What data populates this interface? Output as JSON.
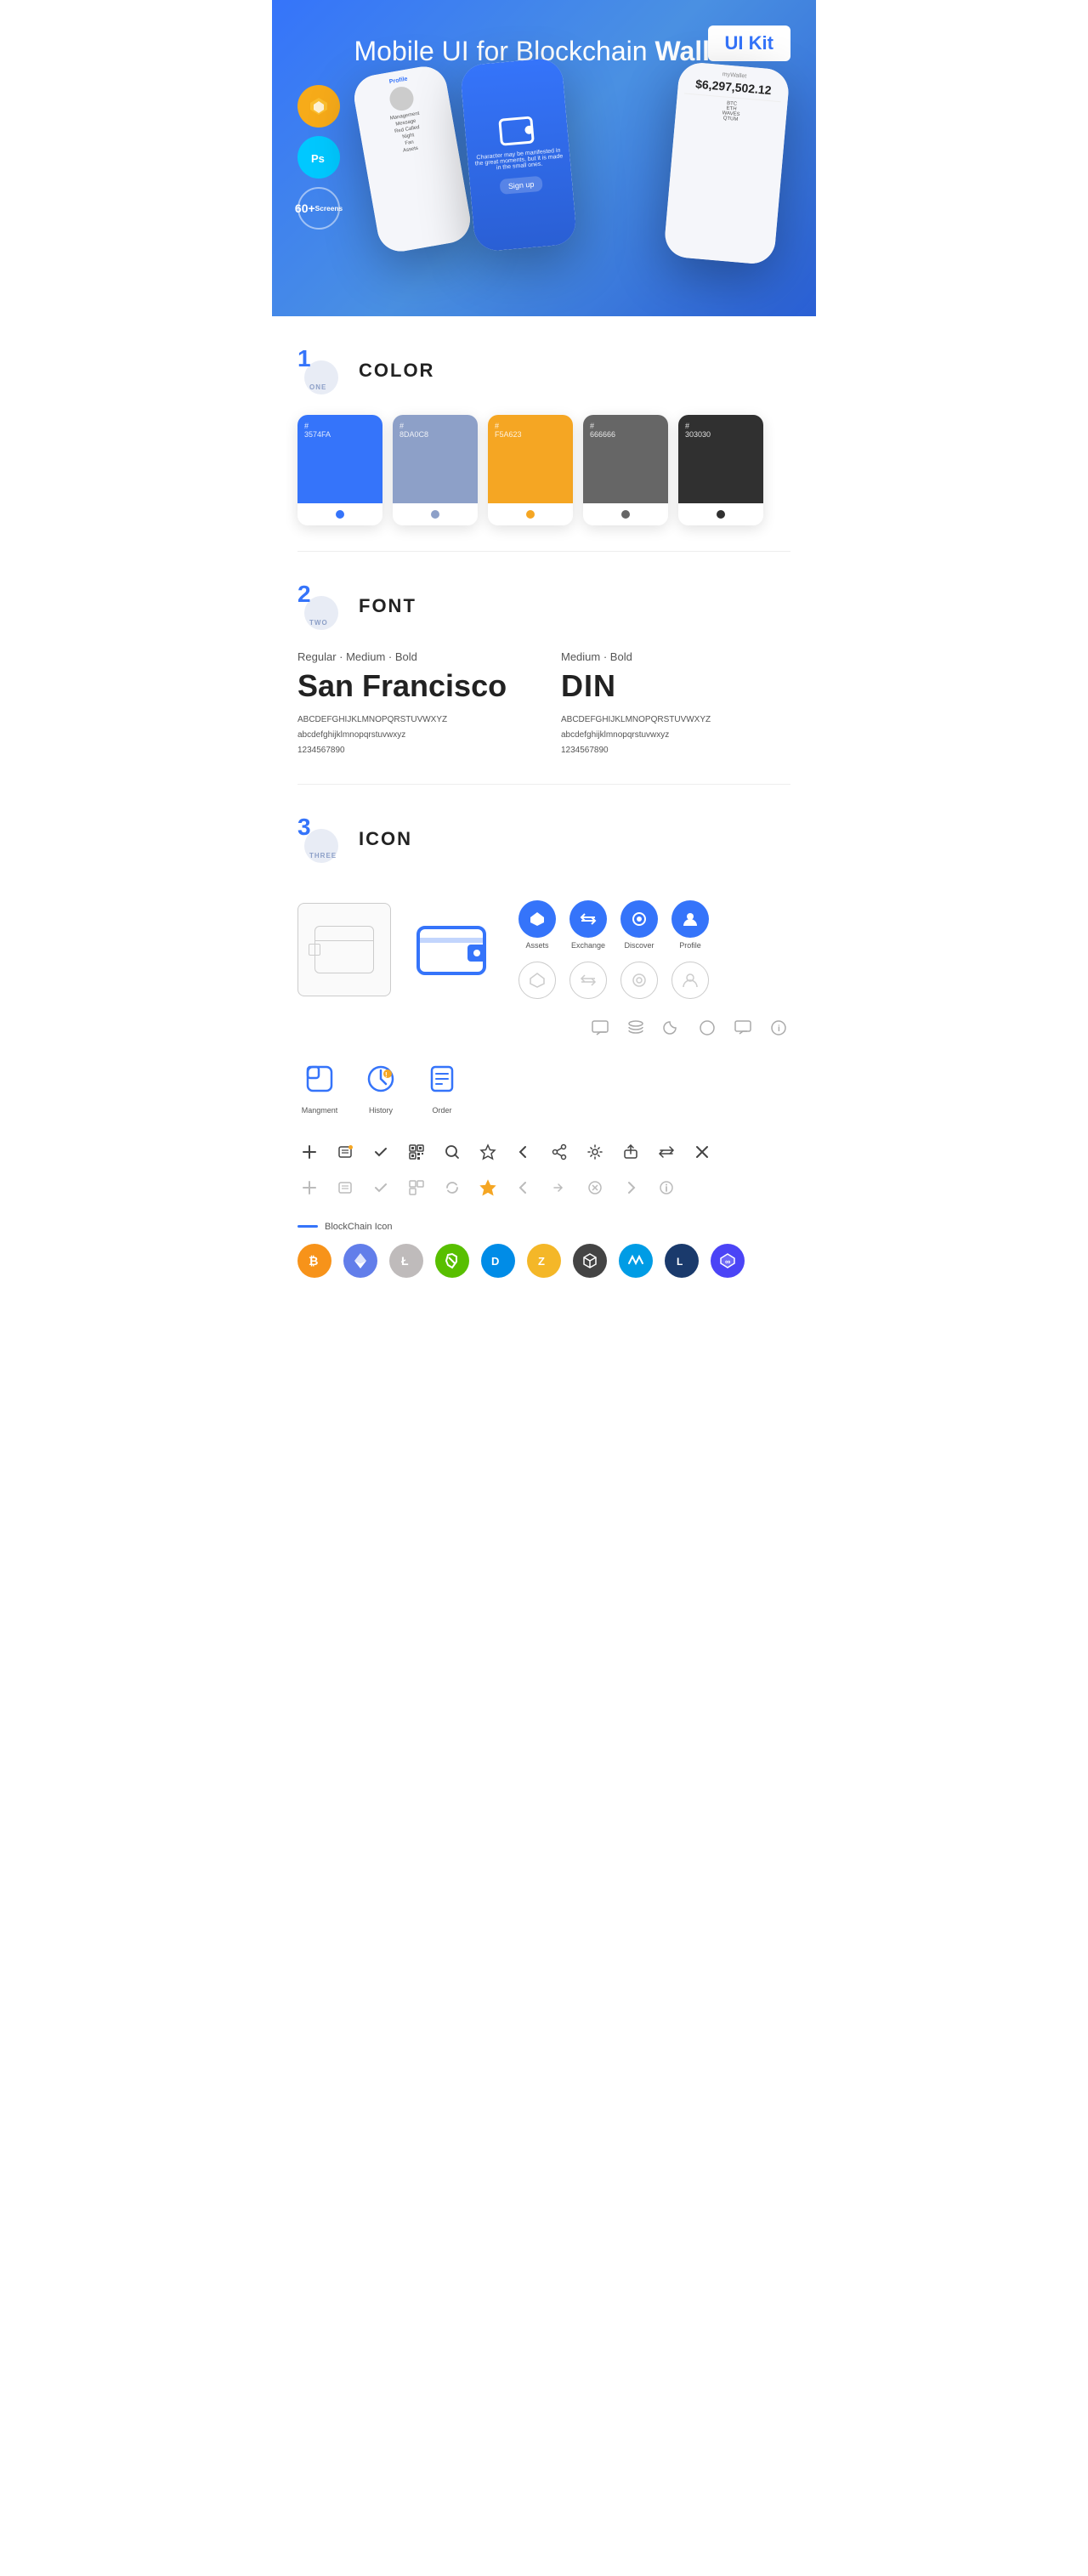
{
  "hero": {
    "title": "Mobile UI for Blockchain ",
    "title_bold": "Wallet",
    "badge": "UI Kit",
    "badge_sketch": "S",
    "badge_ps": "Ps",
    "badge_screens_num": "60+",
    "badge_screens_label": "Screens"
  },
  "sections": {
    "color": {
      "number": "1",
      "number_label": "ONE",
      "title": "COLOR",
      "swatches": [
        {
          "hex": "#3574FA",
          "label": "#\n3574FA",
          "dot": "#3574FA"
        },
        {
          "hex": "#8DA0C8",
          "label": "#\n8DA0C8",
          "dot": "#8DA0C8"
        },
        {
          "hex": "#F5A623",
          "label": "#\nF5A623",
          "dot": "#F5A623"
        },
        {
          "hex": "#666666",
          "label": "#\n666666",
          "dot": "#666666"
        },
        {
          "hex": "#303030",
          "label": "#\n303030",
          "dot": "#303030"
        }
      ]
    },
    "font": {
      "number": "2",
      "number_label": "TWO",
      "title": "FONT",
      "font1": {
        "style": "Regular · Medium · Bold",
        "name": "San Francisco",
        "uppercase": "ABCDEFGHIJKLMNOPQRSTUVWXYZ",
        "lowercase": "abcdefghijklmnopqrstuvwxyz",
        "numbers": "1234567890"
      },
      "font2": {
        "style": "Medium · Bold",
        "name": "DIN",
        "uppercase": "ABCDEFGHIJKLMNOPQRSTUVWXYZ",
        "lowercase": "abcdefghijklmnopqrstuvwxyz",
        "numbers": "1234567890"
      }
    },
    "icon": {
      "number": "3",
      "number_label": "THREE",
      "title": "ICON",
      "nav_icons": [
        {
          "label": "Assets",
          "symbol": "◆"
        },
        {
          "label": "Exchange",
          "symbol": "↕"
        },
        {
          "label": "Discover",
          "symbol": "●"
        },
        {
          "label": "Profile",
          "symbol": "👤"
        }
      ],
      "app_icons": [
        {
          "label": "Mangment",
          "symbol": "▣"
        },
        {
          "label": "History",
          "symbol": "⏱"
        },
        {
          "label": "Order",
          "symbol": "≡"
        }
      ],
      "misc_icons_row1": [
        "■",
        "≡",
        ")",
        "●",
        "▣",
        "ℹ"
      ],
      "misc_icons_row2": [
        "+",
        "☰",
        "✓",
        "⊞",
        "🔍",
        "☆",
        "‹",
        "«",
        "⚙",
        "⬡",
        "⇄",
        "✕"
      ],
      "misc_icons_row2_gray": [
        "+",
        "☰",
        "✓",
        "⊞",
        "↺",
        "☆",
        "‹",
        "↔",
        "✕",
        "→",
        "ℹ"
      ],
      "blockchain_label": "BlockChain Icon",
      "crypto": [
        {
          "symbol": "₿",
          "class": "ci-btc"
        },
        {
          "symbol": "⟠",
          "class": "ci-eth"
        },
        {
          "symbol": "Ł",
          "class": "ci-ltc"
        },
        {
          "symbol": "N",
          "class": "ci-neo"
        },
        {
          "symbol": "D",
          "class": "ci-dash"
        },
        {
          "symbol": "Z",
          "class": "ci-zcash"
        },
        {
          "symbol": "⊕",
          "class": "ci-grid"
        },
        {
          "symbol": "W",
          "class": "ci-waves"
        },
        {
          "symbol": "L",
          "class": "ci-lisk"
        },
        {
          "symbol": "∞",
          "class": "ci-poly"
        }
      ]
    }
  }
}
